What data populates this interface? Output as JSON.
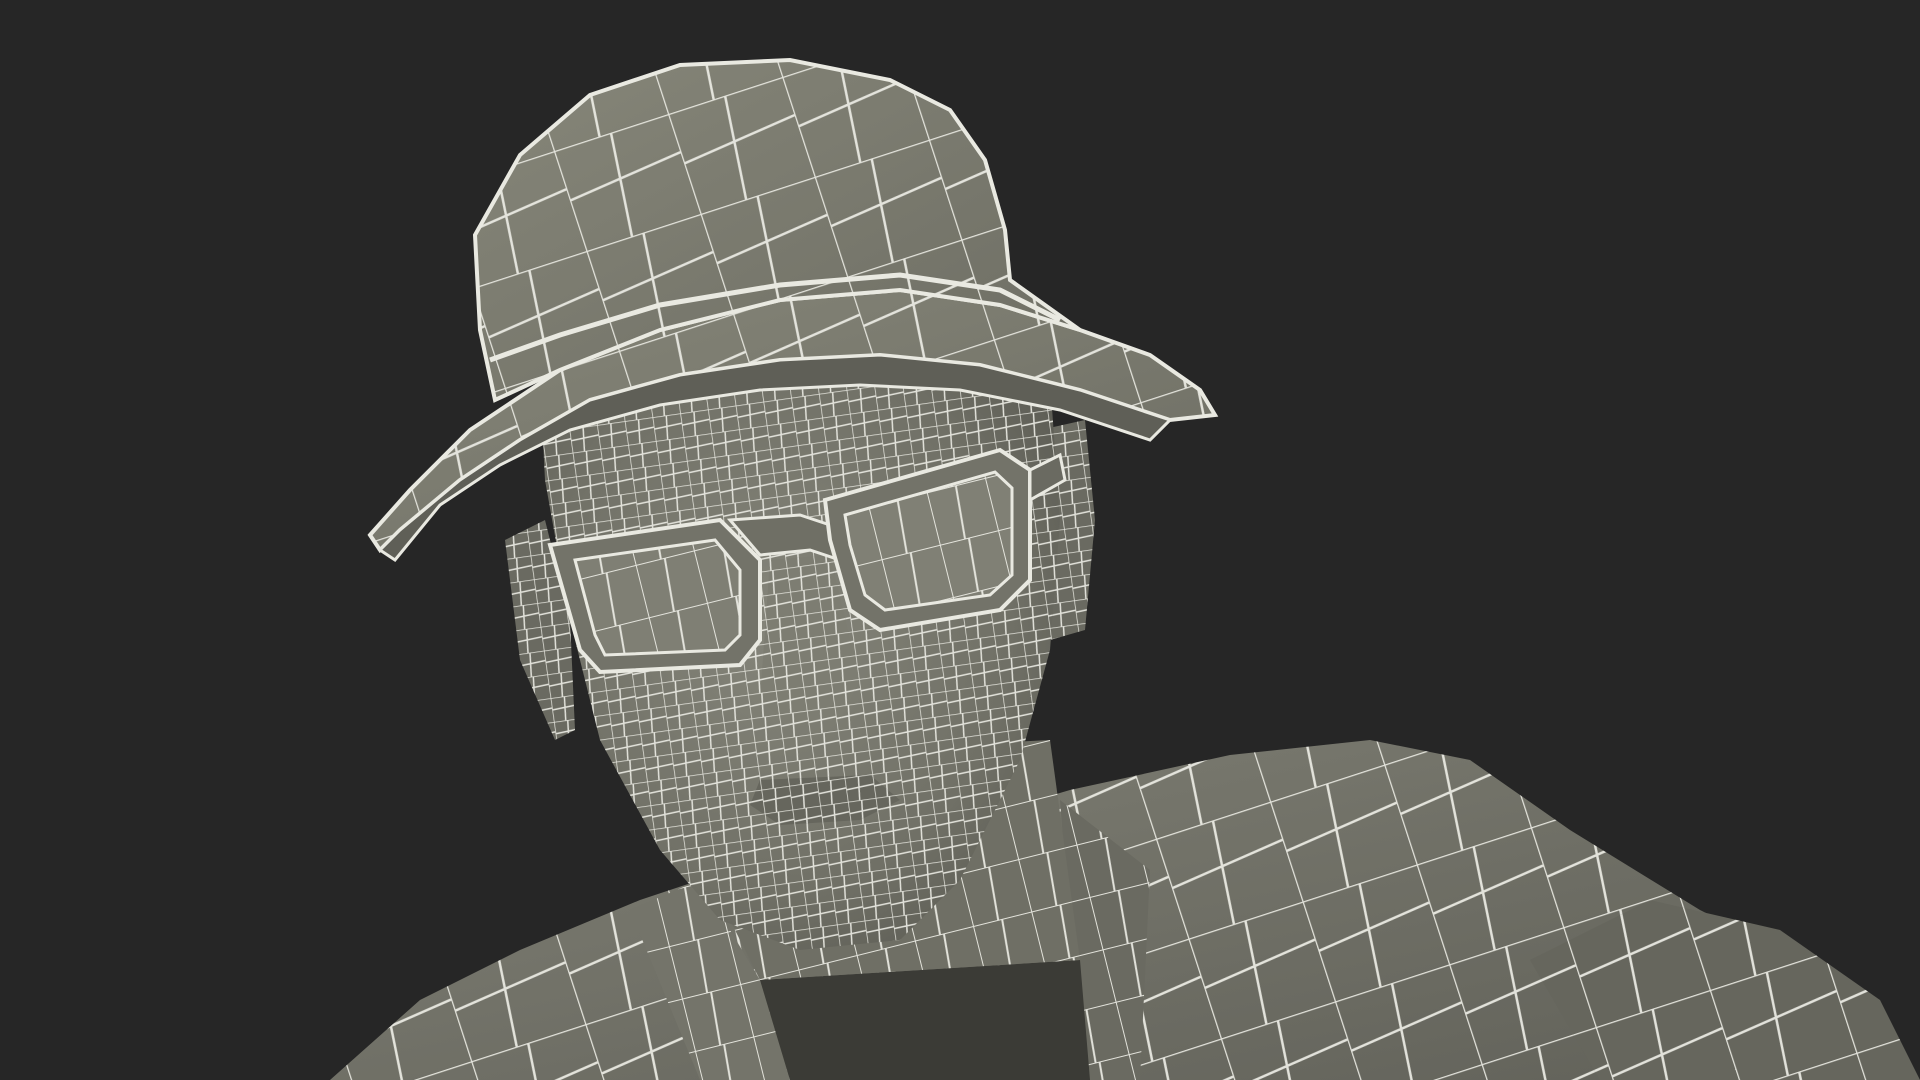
{
  "scene": {
    "background_color": "#262626",
    "surface_color": "#7a7a70",
    "surface_shadow_color": "#5f5f57",
    "surface_highlight_color": "#8a8a7f",
    "wire_color": "#e9e9e1"
  }
}
